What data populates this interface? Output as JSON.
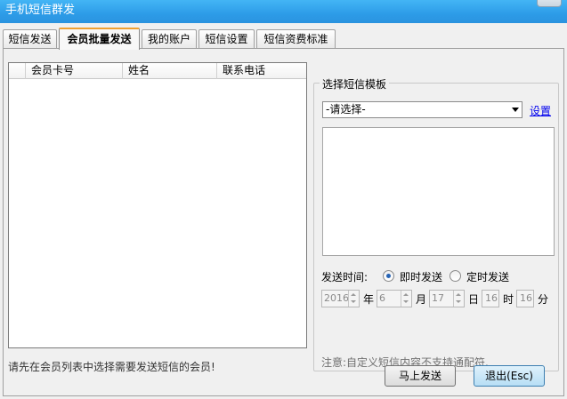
{
  "window": {
    "title": "手机短信群发"
  },
  "tabs": [
    {
      "label": "短信发送"
    },
    {
      "label": "会员批量发送"
    },
    {
      "label": "我的账户"
    },
    {
      "label": "短信设置"
    },
    {
      "label": "短信资费标准"
    }
  ],
  "member_table": {
    "columns": [
      "会员卡号",
      "姓名",
      "联系电话"
    ],
    "rows": []
  },
  "template": {
    "group_label": "选择短信模板",
    "select_value": "-请选择-",
    "settings_link": "设置",
    "content": ""
  },
  "send_time": {
    "label": "发送时间:",
    "options": [
      "即时发送",
      "定时发送"
    ],
    "selected": "即时发送"
  },
  "schedule": {
    "year": "2016",
    "year_unit": "年",
    "month": "6",
    "month_unit": "月",
    "day": "17",
    "day_unit": "日",
    "hour": "16",
    "hour_unit": "时",
    "minute": "16",
    "minute_unit": "分"
  },
  "note": "注意:自定义短信内容不支持通配符.",
  "status_message": "请先在会员列表中选择需要发送短信的会员!",
  "buttons": {
    "send": "马上发送",
    "exit": "退出(Esc)"
  }
}
